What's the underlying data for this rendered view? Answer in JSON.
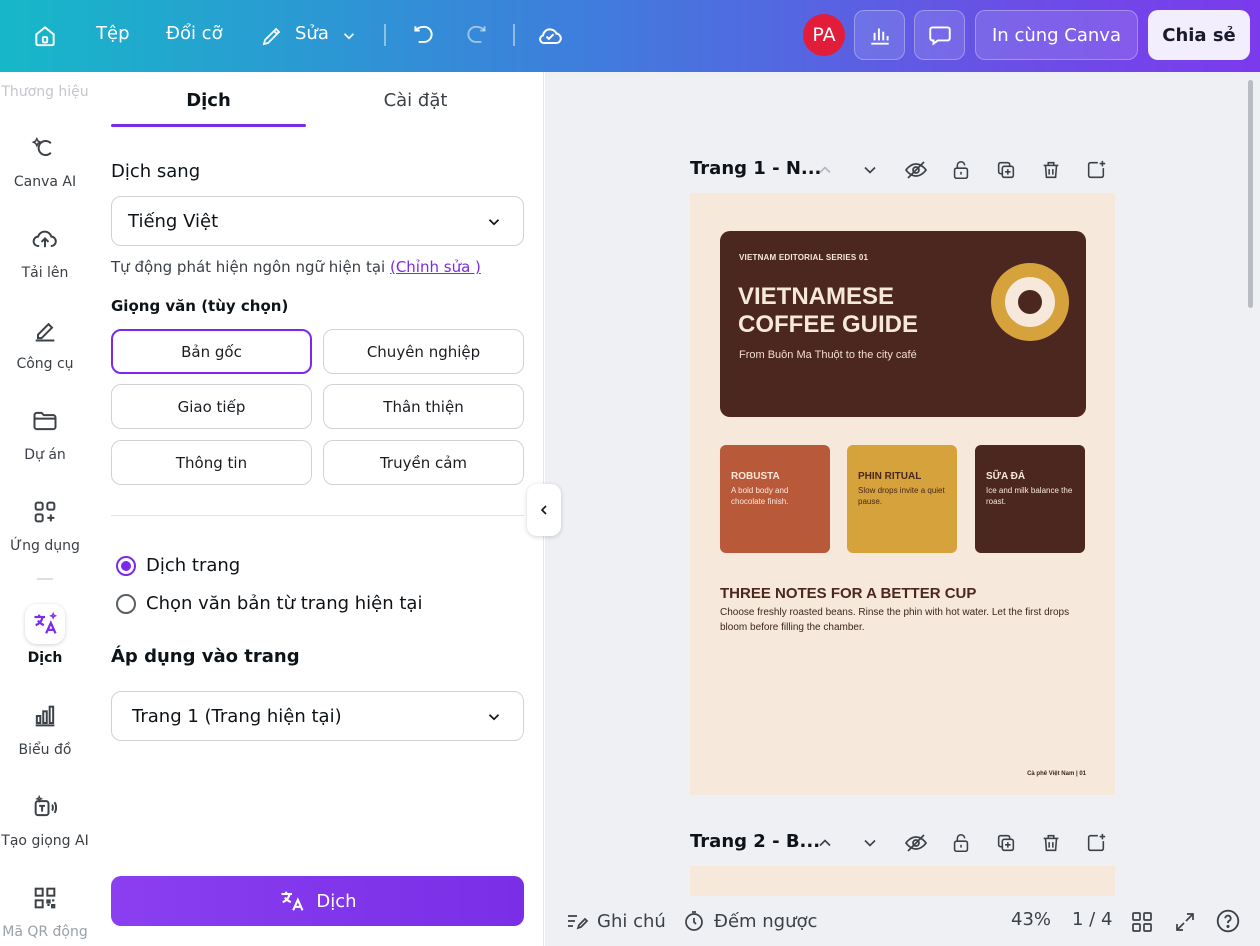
{
  "topbar": {
    "file_label": "Tệp",
    "resize_label": "Đổi cỡ",
    "edit_label": "Sửa",
    "avatar_initials": "PA",
    "print_label": "In cùng Canva",
    "share_label": "Chia sẻ"
  },
  "rail": {
    "top_faded_label": "Thương hiệu",
    "items": [
      {
        "label": "Canva AI",
        "icon": "canva-ai-icon"
      },
      {
        "label": "Tải lên",
        "icon": "upload-cloud-icon"
      },
      {
        "label": "Công cụ",
        "icon": "pen-tool-icon"
      },
      {
        "label": "Dự án",
        "icon": "folder-icon"
      },
      {
        "label": "Ứng dụng",
        "icon": "apps-grid-icon"
      },
      {
        "label": "Dịch",
        "icon": "translate-icon"
      },
      {
        "label": "Biểu đồ",
        "icon": "bar-chart-icon"
      },
      {
        "label": "Tạo giọng AI",
        "icon": "ai-voice-icon"
      },
      {
        "label": "Mã QR động",
        "icon": "qr-code-icon"
      }
    ]
  },
  "panel": {
    "tabs": [
      "Dịch",
      "Cài đặt"
    ],
    "translate_to_label": "Dịch sang",
    "language_value": "Tiếng Việt",
    "auto_detect_text": "Tự động phát hiện ngôn ngữ hiện tại",
    "edit_link": "(Chỉnh sửa )",
    "tone_label": "Giọng văn (tùy chọn)",
    "tones": [
      "Bản gốc",
      "Chuyên nghiệp",
      "Giao tiếp",
      "Thân thiện",
      "Thông tin",
      "Truyền cảm"
    ],
    "selected_tone": "Bản gốc",
    "radio_options": [
      "Dịch trang",
      "Chọn văn bản từ trang hiện tại"
    ],
    "apply_label": "Áp dụng vào trang",
    "page_select_value": "Trang 1 (Trang hiện tại)",
    "translate_button": "Dịch"
  },
  "canvas": {
    "page1_title": "Trang 1 - N...",
    "page2_title": "Trang 2 - B...",
    "design": {
      "series": "VIETNAM EDITORIAL SERIES 01",
      "title_line1": "VIETNAMESE",
      "title_line2": "COFFEE GUIDE",
      "subtitle": "From Buôn Ma Thuột to the city café",
      "cards": [
        {
          "title": "ROBUSTA",
          "desc": "A bold body and chocolate finish.",
          "color": "#b85a3a"
        },
        {
          "title": "PHIN RITUAL",
          "desc": "Slow drops invite a quiet pause.",
          "color": "#d6a23c"
        },
        {
          "title": "SỮA ĐÁ",
          "desc": "Ice and milk balance the roast.",
          "color": "#4b2720"
        }
      ],
      "notes_title": "THREE NOTES FOR A BETTER CUP",
      "notes_body": "Choose freshly roasted beans. Rinse the phin with hot water. Let the first drops bloom before filling the chamber.",
      "footer": "Cà phê Việt Nam | 01"
    }
  },
  "bottombar": {
    "notes_label": "Ghi chú",
    "timer_label": "Đếm ngược",
    "zoom": "43%",
    "page_counter": "1 / 4"
  },
  "colors": {
    "accent": "#7d2ae8",
    "page_bg": "#f6e8da",
    "hero_bg": "#4b2720"
  }
}
